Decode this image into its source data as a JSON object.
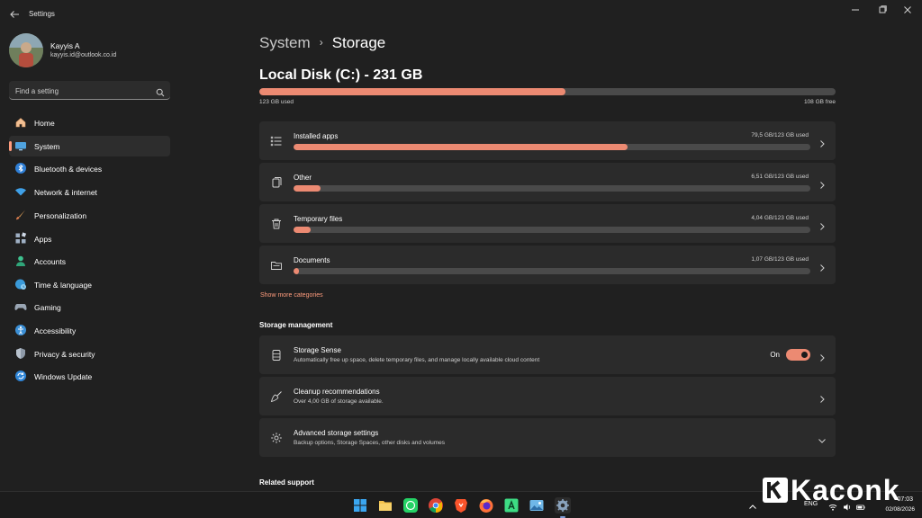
{
  "window": {
    "title": "Settings"
  },
  "profile": {
    "name": "Kayyis A",
    "email": "kayyis.id@outlook.co.id"
  },
  "search": {
    "placeholder": "Find a setting"
  },
  "sidebar": {
    "items": [
      {
        "label": "Home",
        "icon": "home-icon"
      },
      {
        "label": "System",
        "icon": "monitor-icon",
        "active": true
      },
      {
        "label": "Bluetooth & devices",
        "icon": "bluetooth-icon"
      },
      {
        "label": "Network & internet",
        "icon": "wifi-icon"
      },
      {
        "label": "Personalization",
        "icon": "brush-icon"
      },
      {
        "label": "Apps",
        "icon": "apps-icon"
      },
      {
        "label": "Accounts",
        "icon": "person-icon"
      },
      {
        "label": "Time & language",
        "icon": "globe-clock-icon"
      },
      {
        "label": "Gaming",
        "icon": "gamepad-icon"
      },
      {
        "label": "Accessibility",
        "icon": "accessibility-icon"
      },
      {
        "label": "Privacy & security",
        "icon": "shield-icon"
      },
      {
        "label": "Windows Update",
        "icon": "update-icon"
      }
    ]
  },
  "breadcrumb": {
    "parent": "System",
    "separator": "›",
    "current": "Storage"
  },
  "disk": {
    "title": "Local Disk (C:) - 231 GB",
    "used_label": "123 GB used",
    "free_label": "108 GB free",
    "used_fraction": 0.532
  },
  "categories": [
    {
      "title": "Installed apps",
      "value": "79,5 GB/123 GB used",
      "fraction": 0.646,
      "icon": "list-icon"
    },
    {
      "title": "Other",
      "value": "6,51 GB/123 GB used",
      "fraction": 0.053,
      "icon": "document-copy-icon"
    },
    {
      "title": "Temporary files",
      "value": "4,04 GB/123 GB used",
      "fraction": 0.033,
      "icon": "trash-icon"
    },
    {
      "title": "Documents",
      "value": "1,07 GB/123 GB used",
      "fraction": 0.009,
      "icon": "folder-icon"
    }
  ],
  "show_more": "Show more categories",
  "storage_management": {
    "heading": "Storage management",
    "items": [
      {
        "title": "Storage Sense",
        "subtitle": "Automatically free up space, delete temporary files, and manage locally available cloud content",
        "toggle_label": "On",
        "toggle_on": true,
        "icon": "drive-icon"
      },
      {
        "title": "Cleanup recommendations",
        "subtitle": "Over 4,00 GB of storage available.",
        "icon": "broom-icon"
      },
      {
        "title": "Advanced storage settings",
        "subtitle": "Backup options, Storage Spaces, other disks and volumes",
        "icon": "gear-icon"
      }
    ]
  },
  "related_support": {
    "heading": "Related support"
  },
  "taskbar": {
    "apps": [
      "windows-start-icon",
      "file-explorer-icon",
      "whatsapp-icon",
      "chrome-icon",
      "brave-icon",
      "firefox-icon",
      "android-studio-icon",
      "photos-icon",
      "settings-app-icon"
    ],
    "language": "ENG",
    "time": "07:03",
    "date": "02/08/2026"
  },
  "watermark": {
    "text": "Kaconk"
  },
  "colors": {
    "accent": "#ec8a72",
    "accent_text": "#ff9c7d",
    "background": "#202020",
    "card": "#2b2b2b",
    "bar_track": "#4a4a4a"
  }
}
